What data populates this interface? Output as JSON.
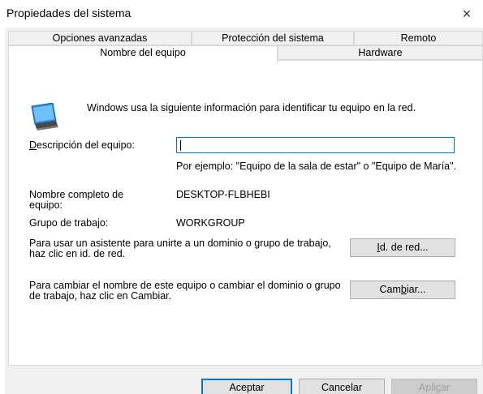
{
  "window": {
    "title": "Propiedades del sistema",
    "close_glyph": "×"
  },
  "tabs": {
    "row1": [
      "Opciones avanzadas",
      "Protección del sistema",
      "Remoto"
    ],
    "row2": [
      "Nombre del equipo",
      "Hardware"
    ],
    "active": "Nombre del equipo"
  },
  "panel": {
    "intro": "Windows usa la siguiente información para identificar tu equipo en la red.",
    "description_label_u": "D",
    "description_label_rest": "escripción del equipo:",
    "description_value": "",
    "example": "Por ejemplo: \"Equipo de la sala de estar\" o \"Equipo de María\".",
    "fullname_label": "Nombre completo de equipo:",
    "fullname_value": "DESKTOP-FLBHEBI",
    "workgroup_label": "Grupo de trabajo:",
    "workgroup_value": "WORKGROUP",
    "network_text": "Para usar un asistente para unirte a un dominio o grupo de trabajo, haz clic en id. de red.",
    "network_btn_u": "I",
    "network_btn_rest": "d. de red...",
    "rename_text": "Para cambiar el nombre de este equipo o cambiar el dominio o grupo de trabajo, haz clic en Cambiar.",
    "rename_btn_pre": "Cam",
    "rename_btn_u": "b",
    "rename_btn_post": "iar..."
  },
  "footer": {
    "ok": "Aceptar",
    "cancel": "Cancelar",
    "apply_pre": "Apli",
    "apply_u": "c",
    "apply_post": "ar"
  },
  "colors": {
    "dialog_bg": "#f0f0f0",
    "accent": "#0078d7",
    "button_bg": "#e1e1e1"
  }
}
